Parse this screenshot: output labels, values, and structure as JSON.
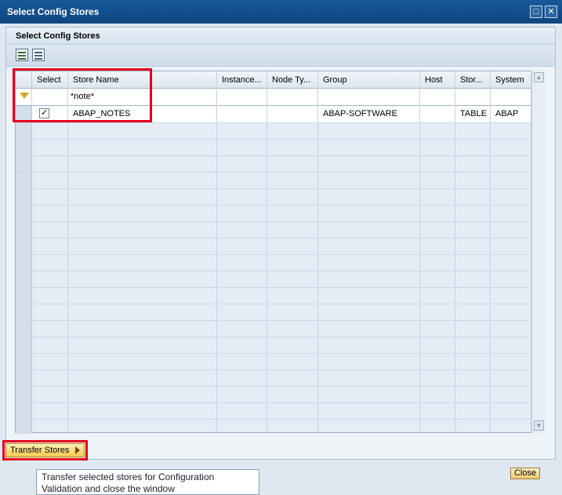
{
  "window": {
    "title": "Select Config Stores",
    "controls": [
      "restore-icon",
      "close-icon"
    ]
  },
  "panel": {
    "title": "Select Config Stores"
  },
  "toolbar": {
    "icons": [
      "select-all-icon",
      "deselect-all-icon"
    ]
  },
  "table": {
    "columns": [
      "Select",
      "Store Name",
      "Instance...",
      "Node Ty...",
      "Group",
      "Host",
      "Stor...",
      "System"
    ],
    "filter": {
      "store_name": "*note*"
    },
    "rows": [
      {
        "select": true,
        "store_name": "ABAP_NOTES",
        "instance": "",
        "node_type": "",
        "group": "ABAP-SOFTWARE",
        "host": "",
        "store_type": "TABLE",
        "system": "ABAP"
      }
    ]
  },
  "buttons": {
    "transfer": "Transfer Stores",
    "close": "Close"
  },
  "tooltip": {
    "text": "Transfer selected stores for Configuration Validation and close the window"
  },
  "colors": {
    "title_bar": "#0e4680",
    "highlight_border": "#e3001b",
    "button_face": "#f4c74f"
  }
}
